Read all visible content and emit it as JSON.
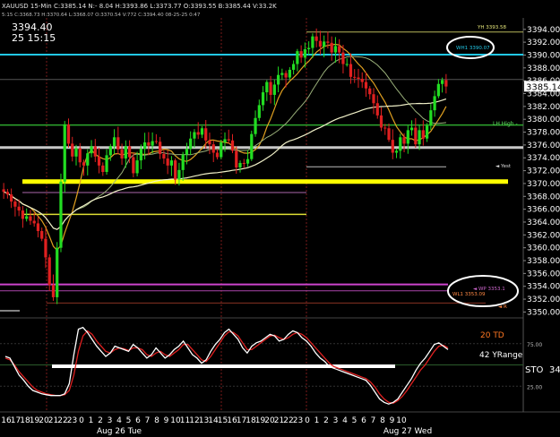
{
  "header": {
    "info_line": "XAUUSD 15-Min C:3385.14 N:- 8.04 H:3393.86 L:3373.77 O:3393.55 B:3385.44 V:33.2K",
    "price": "3394.40",
    "datetime": "25 15:15",
    "sub_line": "5:15 C:3368.73 H:3370.64 L:3368.07 O:3370.54 V:772 C:3394.40 08-25-25 0:47"
  },
  "chart_data": [
    {
      "type": "candlestick",
      "title": "XAUUSD 15-Min",
      "y_ticks": [
        "3394.00",
        "3392.00",
        "3390.00",
        "3388.00",
        "3386.00",
        "3384.00",
        "3382.00",
        "3380.00",
        "3378.00",
        "3376.00",
        "3374.00",
        "3372.00",
        "3370.00",
        "3368.00",
        "3366.00",
        "3364.00",
        "3362.00",
        "3360.00",
        "3358.00",
        "3356.00",
        "3354.00",
        "3352.00",
        "3350.00"
      ],
      "ylim": [
        3349.5,
        3395.5
      ],
      "last_price": "3385.14",
      "closes": [
        3368.7,
        3368.3,
        3367.2,
        3366.4,
        3365.8,
        3364.5,
        3364.9,
        3364.2,
        3363.8,
        3362.6,
        3361.4,
        3358.5,
        3354.2,
        3352.3,
        3360.0,
        3370.3,
        3379.2,
        3376.2,
        3374.2,
        3375.5,
        3373.3,
        3372.8,
        3374.7,
        3375.8,
        3374.2,
        3372.8,
        3371.8,
        3374.4,
        3375.8,
        3377.2,
        3375.3,
        3373.9,
        3375.8,
        3374.1,
        3371.6,
        3373.6,
        3375.4,
        3376.4,
        3375.9,
        3376.6,
        3376.5,
        3374.6,
        3373.9,
        3372.8,
        3373.6,
        3370.6,
        3372.1,
        3374.5,
        3375.4,
        3377.0,
        3378.0,
        3377.6,
        3378.6,
        3376.7,
        3376.1,
        3374.8,
        3374.1,
        3376.4,
        3376.9,
        3376.7,
        3375.1,
        3372.5,
        3373.2,
        3373.1,
        3373.8,
        3377.7,
        3380.2,
        3382.2,
        3384.2,
        3385.8,
        3383.8,
        3385.4,
        3386.9,
        3387.2,
        3386.5,
        3387.7,
        3388.6,
        3390.6,
        3389.6,
        3390.9,
        3391.1,
        3392.9,
        3392.2,
        3391.3,
        3392.1,
        3391.9,
        3390.4,
        3391.4,
        3390.4,
        3388.6,
        3388.6,
        3386.6,
        3386.5,
        3386.3,
        3385.8,
        3384.8,
        3383.9,
        3382.5,
        3380.6,
        3378.7,
        3378.6,
        3376.8,
        3374.8,
        3375.1,
        3377.2,
        3376.2,
        3378.3,
        3378.7,
        3376.1,
        3378.3,
        3377.0,
        3379.0,
        3381.4,
        3383.6,
        3385.5,
        3386.1,
        3385.1
      ]
    },
    {
      "type": "line",
      "title": "STO",
      "series": [
        {
          "name": "%K",
          "color": "#ffffff",
          "values": [
            60,
            58,
            48,
            38,
            32,
            25,
            20,
            18,
            16,
            15,
            14,
            14,
            14,
            16,
            28,
            62,
            92,
            94,
            88,
            80,
            72,
            66,
            60,
            64,
            72,
            70,
            68,
            66,
            74,
            70,
            64,
            58,
            62,
            70,
            64,
            58,
            62,
            68,
            72,
            78,
            70,
            62,
            58,
            52,
            56,
            66,
            74,
            80,
            88,
            92,
            86,
            80,
            70,
            64,
            72,
            76,
            78,
            82,
            86,
            84,
            78,
            80,
            86,
            90,
            88,
            82,
            78,
            72,
            64,
            58,
            54,
            48,
            46,
            44,
            42,
            40,
            38,
            36,
            34,
            32,
            26,
            18,
            10,
            6,
            4,
            6,
            10,
            18,
            26,
            34,
            44,
            52,
            58,
            66,
            74,
            76,
            72,
            68
          ]
        },
        {
          "name": "%D",
          "color": "#e02020",
          "values": [
            58,
            56,
            50,
            42,
            36,
            30,
            24,
            20,
            18,
            16,
            15,
            14,
            14,
            15,
            20,
            38,
            66,
            84,
            90,
            86,
            78,
            72,
            66,
            64,
            68,
            70,
            69,
            67,
            70,
            70,
            68,
            62,
            60,
            64,
            66,
            62,
            60,
            64,
            68,
            74,
            74,
            68,
            62,
            56,
            54,
            60,
            68,
            76,
            84,
            89,
            88,
            84,
            76,
            68,
            68,
            72,
            76,
            80,
            84,
            85,
            82,
            80,
            82,
            86,
            88,
            86,
            82,
            76,
            70,
            64,
            58,
            52,
            48,
            46,
            44,
            42,
            40,
            38,
            36,
            34,
            30,
            24,
            16,
            10,
            6,
            5,
            8,
            13,
            20,
            28,
            36,
            44,
            50,
            58,
            66,
            72,
            73,
            70
          ]
        }
      ],
      "y_ticks": [
        "75.00",
        "25.00"
      ],
      "label": "STO",
      "value": "34"
    }
  ],
  "x_labels": {
    "hours": [
      "16",
      "17",
      "18",
      "19",
      "20",
      "21",
      "22",
      "23",
      "0",
      "1",
      "2",
      "3",
      "4",
      "5",
      "6",
      "7",
      "8",
      "9",
      "10",
      "11",
      "12",
      "13",
      "14",
      "15",
      "16",
      "17",
      "18",
      "19",
      "20",
      "21",
      "22",
      "23",
      "0",
      "1",
      "2",
      "3",
      "4",
      "5",
      "6",
      "7",
      "8",
      "9",
      "10"
    ],
    "dates": [
      "Aug 26 Tue",
      "Aug 27 Wed"
    ]
  },
  "annotations": {
    "yh_label": "YH 3393.58",
    "wh_label": "WH1 3390.07",
    "lh_label": "LH High -",
    "yest_label": "◄ Yest",
    "wp_label": "◄ WP 3353.1",
    "wl_label": "WL1 3353.09",
    "r_label": "◄ R",
    "td_label": "20 TD",
    "yrange_label": "42 YRange"
  },
  "colors": {
    "background": "#000000",
    "up_candle": "#22dd22",
    "down_candle": "#e02020",
    "cyan_level": "#22c8e8",
    "yellow_level": "#ffff00",
    "green_level": "#2ea82e",
    "grey_level": "#c8c8c8",
    "magenta_level": "#cc44cc"
  }
}
